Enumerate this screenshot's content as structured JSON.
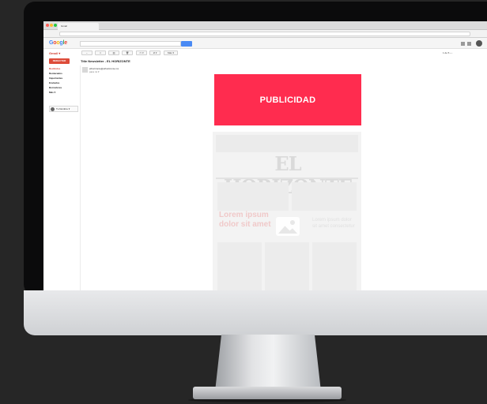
{
  "browser": {
    "tab_label": "Gmail",
    "dot_colors": [
      "#ff5f57",
      "#febc2e",
      "#28c840"
    ]
  },
  "gmail": {
    "logo_text": "Google",
    "logo_colors": [
      "#4285f4",
      "#ea4335",
      "#fbbc05",
      "#4285f4",
      "#34a853",
      "#ea4335"
    ],
    "label": "Gmail ▾",
    "toolbar": [
      "←",
      "□",
      "▥",
      "🗑",
      "▭ ▾",
      "⊘ ▾",
      "Más ▾"
    ],
    "pager": "1 de 5 ‹ ›",
    "compose": "REDACTAR",
    "nav": [
      {
        "label": "Recibidos",
        "active": true
      },
      {
        "label": "Destacados",
        "active": false
      },
      {
        "label": "Importantes",
        "active": false
      },
      {
        "label": "Enviados",
        "active": false
      },
      {
        "label": "Borradores",
        "active": false
      },
      {
        "label": "Más ▾",
        "active": false
      }
    ],
    "hangout_user": "Tu Nombre ▾"
  },
  "email": {
    "subject": "Title Newsletter - EL HORIZONTE",
    "sender": "elhorizonte@elhorizonte.mx",
    "to": "para mí ▾",
    "ad_label": "PUBLICIDAD",
    "newspaper_masthead": "EL HORIZONTE",
    "newspaper_headline": "Lorem ipsum dolor sit amet",
    "newspaper_side": "Lorem ipsum dolor sit amet consectetur"
  },
  "colors": {
    "ad": "#ff2c4f",
    "compose": "#dd4b39",
    "search_button": "#4a8af4"
  },
  "icons": [
    "image-placeholder-icon",
    "settings-icon",
    "apps-icon",
    "avatar"
  ]
}
